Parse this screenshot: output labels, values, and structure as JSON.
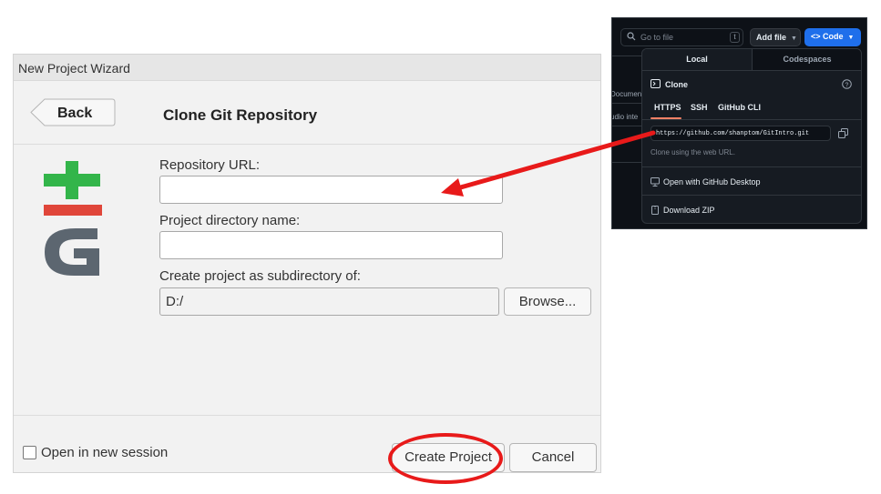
{
  "wizard": {
    "title": "New Project Wizard",
    "back_label": "Back",
    "heading": "Clone Git Repository",
    "repo_url_label": "Repository URL:",
    "repo_url_value": "",
    "dir_name_label": "Project directory name:",
    "dir_name_value": "",
    "subdir_label": "Create project as subdirectory of:",
    "subdir_value": "D:/",
    "browse_label": "Browse...",
    "new_session_label": "Open in new session",
    "new_session_checked": false,
    "create_label": "Create Project",
    "cancel_label": "Cancel"
  },
  "github": {
    "search_placeholder": "Go to file",
    "search_shortcut": "t",
    "add_file_label": "Add file",
    "code_label": "Code",
    "sidebar_fragments": [
      "Documen",
      "udio inte"
    ],
    "tabs": [
      "Local",
      "Codespaces"
    ],
    "active_tab": "Local",
    "clone_title": "Clone",
    "protocols": [
      "HTTPS",
      "SSH",
      "GitHub CLI"
    ],
    "active_protocol": "HTTPS",
    "clone_url": "https://github.com/shanptom/GitIntro.git",
    "clone_hint": "Clone using the web URL.",
    "open_desktop_label": "Open with GitHub Desktop",
    "download_zip_label": "Download ZIP"
  },
  "colors": {
    "annotation_red": "#e81a1a",
    "git_green": "#33b54a",
    "git_red": "#e0463a",
    "git_gray": "#5c6670",
    "github_blue": "#1f6feb",
    "github_bg": "#0d1117"
  }
}
